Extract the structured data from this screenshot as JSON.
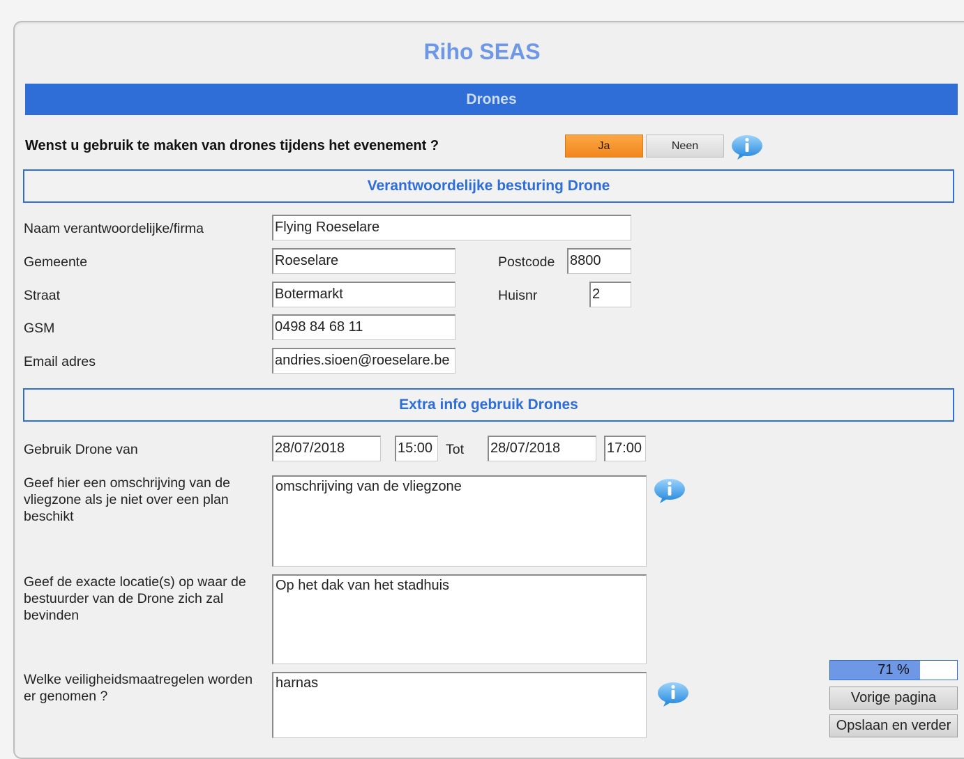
{
  "app": {
    "title": "Riho SEAS"
  },
  "banner": {
    "title": "Drones"
  },
  "question": {
    "text": "Wenst u gebruik te maken van drones tijdens het evenement ?",
    "yes_label": "Ja",
    "no_label": "Neen",
    "selected": "Ja"
  },
  "section1": {
    "title": "Verantwoordelijke besturing Drone",
    "name_label": "Naam verantwoordelijke/firma",
    "name_value": "Flying Roeselare",
    "gemeente_label": "Gemeente",
    "gemeente_value": "Roeselare",
    "postcode_label": "Postcode",
    "postcode_value": "8800",
    "straat_label": "Straat",
    "straat_value": "Botermarkt",
    "huisnr_label": "Huisnr",
    "huisnr_value": "2",
    "gsm_label": "GSM",
    "gsm_value": "0498 84 68 11",
    "email_label": "Email adres",
    "email_value": "andries.sioen@roeselare.be"
  },
  "section2": {
    "title": "Extra info gebruik Drones",
    "use_label": "Gebruik Drone van",
    "from_date": "28/07/2018",
    "from_time": "15:00",
    "tot_label": "Tot",
    "to_date": "28/07/2018",
    "to_time": "17:00",
    "desc_label": "Geef hier een omschrijving van de vliegzone als je niet over een plan beschikt",
    "desc_value": "omschrijving van de vliegzone",
    "location_label": "Geef de exacte locatie(s) op waar de bestuurder van de Drone zich zal bevinden",
    "location_value": "Op het dak van het stadhuis",
    "safety_label": "Welke veiligheidsmaatregelen worden er genomen ?",
    "safety_value": "harnas"
  },
  "progress": {
    "text": "71 %",
    "value": 0.71
  },
  "navigation": {
    "prev_label": "Vorige pagina",
    "next_label": "Opslaan en verder"
  },
  "icons": {
    "info": "info-speech-bubble-icon"
  },
  "colors": {
    "accent": "#2e6ed6",
    "title": "#6e97e6",
    "selected_button": "#f2861e"
  }
}
